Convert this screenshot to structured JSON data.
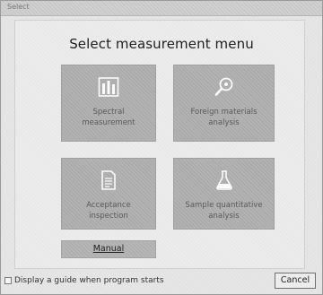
{
  "window": {
    "title": "Select"
  },
  "heading": "Select measurement menu",
  "tiles": [
    {
      "icon": "bar-spectrum-icon",
      "label": "Spectral measurement"
    },
    {
      "icon": "magnifier-search-icon",
      "label": "Foreign materials analysis"
    },
    {
      "icon": "document-icon",
      "label": "Acceptance inspection"
    },
    {
      "icon": "flask-icon",
      "label": "Sample quantitative analysis"
    }
  ],
  "manual_button": "Manual",
  "guide_checkbox": {
    "label": "Display a guide when program starts",
    "checked": false
  },
  "cancel_button": "Cancel",
  "colors": {
    "tile_bg": "#b2b2b2",
    "window_bg": "#e6e6e6",
    "text": "#222222"
  }
}
